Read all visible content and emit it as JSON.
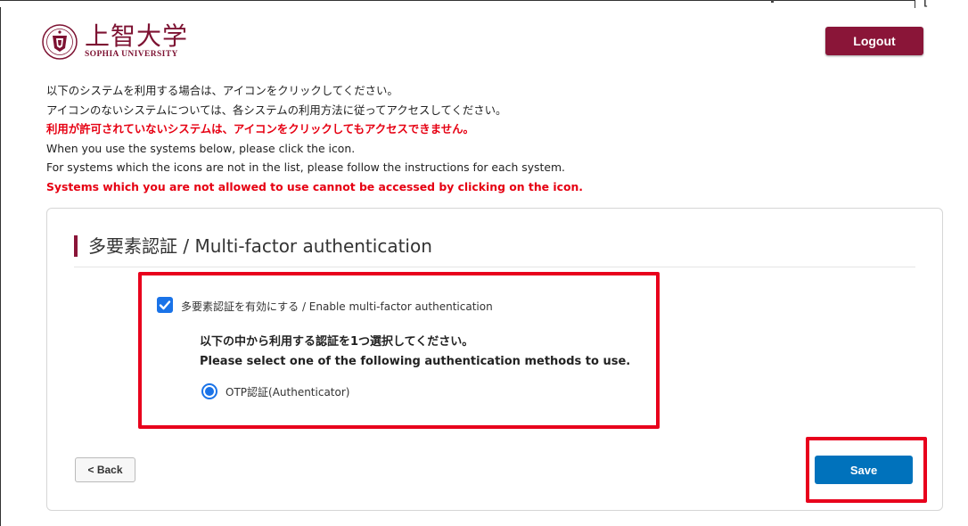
{
  "header": {
    "logo_jp": "上智大学",
    "logo_en": "SOPHIA UNIVERSITY",
    "logout_label": "Logout",
    "corner_mark": "["
  },
  "notice": {
    "jp_line1": "以下のシステムを利用する場合は、アイコンをクリックしてください。",
    "jp_line2": "アイコンのないシステムについては、各システムの利用方法に従ってアクセスしてください。",
    "jp_warning": "利用が許可されていないシステムは、アイコンをクリックしてもアクセスできません。",
    "en_line1": "When you use the systems below, please click the icon.",
    "en_line2": "For systems which the icons are not in the list, please follow the instructions for each system.",
    "en_warning": "Systems which you are not allowed to use cannot be accessed by clicking on the icon."
  },
  "card": {
    "title": "多要素認証 / Multi-factor authentication",
    "mfa_checkbox": {
      "checked": true,
      "label_jp": "多要素認証を有効にする",
      "label_en": " / Enable multi-factor authentication"
    },
    "instruction_jp": "以下の中から利用する認証を1つ選択してください。",
    "instruction_en": "Please select one of the following authentication methods to use.",
    "method_option": {
      "selected": true,
      "label": "OTP認証(Authenticator)"
    },
    "back_label": "< Back",
    "save_label": "Save"
  },
  "colors": {
    "brand": "#8a1538",
    "save": "#0072bc",
    "warning": "#e60012",
    "highlight": "#e8001c",
    "control": "#1a73e8"
  }
}
